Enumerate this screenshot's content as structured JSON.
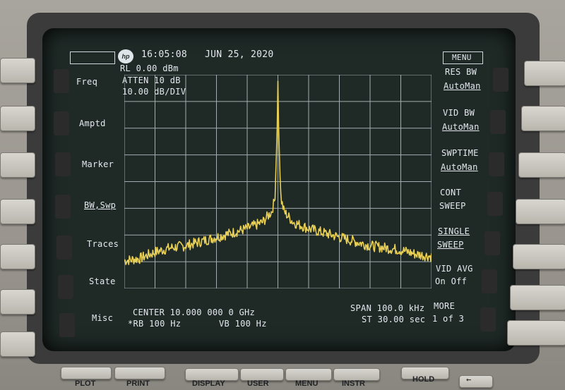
{
  "header": {
    "time": "16:05:08",
    "date": "JUN 25, 2020",
    "ref_level": "RL 0.00 dBm",
    "attenuation": "ATTEN 10 dB",
    "scale": "10.00 dB/DIV",
    "menu_title": "MENU",
    "logo_text": "hp"
  },
  "left_softkeys": [
    "Freq",
    "Amptd",
    "Marker",
    "BW,Swp",
    "Traces",
    "State",
    "Misc"
  ],
  "right_softkeys": [
    {
      "line1": "RES BW",
      "line2": "AutoMan"
    },
    {
      "line1": "VID BW",
      "line2": "AutoMan"
    },
    {
      "line1": "SWPTIME",
      "line2": "AutoMan"
    },
    {
      "line1": "CONT",
      "line2": "SWEEP"
    },
    {
      "line1": "SINGLE",
      "line2": "SWEEP"
    },
    {
      "line1": "VID AVG",
      "line2": "On Off"
    },
    {
      "line1": "MORE",
      "line2": "1 of 3"
    }
  ],
  "footer": {
    "center": "CENTER 10.000 000 0 GHz",
    "rbw": "*RB 100 Hz",
    "vbw": "VB 100 Hz",
    "span": "SPAN 100.0 kHz",
    "sweep_time": "ST 30.00 sec"
  },
  "hardware_keys": [
    "PLOT",
    "PRINT",
    "DISPLAY",
    "USER",
    "MENU",
    "INSTR",
    "HOLD"
  ],
  "colors": {
    "trace": "#e8cf55",
    "graticule": "#b9c3c8",
    "screen_text": "#e4e8ee"
  },
  "chart_data": {
    "type": "line",
    "title": "",
    "xlabel": "",
    "ylabel": "",
    "x_range_khz": [
      -50,
      50
    ],
    "y_range_db": [
      -100,
      0
    ],
    "grid": true,
    "series": [
      {
        "x_khz": [
          -50,
          -45,
          -40,
          -35,
          -30,
          -25,
          -20,
          -15,
          -10,
          -5,
          -2,
          -1,
          -0.3,
          0,
          0.3,
          1,
          2,
          5,
          10,
          15,
          20,
          25,
          30,
          35,
          40,
          45,
          50
        ],
        "y_db": [
          -87,
          -86,
          -83,
          -81,
          -80,
          -78,
          -76,
          -74,
          -72,
          -69,
          -64,
          -58,
          -30,
          -3,
          -30,
          -58,
          -64,
          -69,
          -72,
          -74,
          -76,
          -78,
          -80,
          -81,
          -82,
          -84,
          -85
        ]
      }
    ]
  }
}
